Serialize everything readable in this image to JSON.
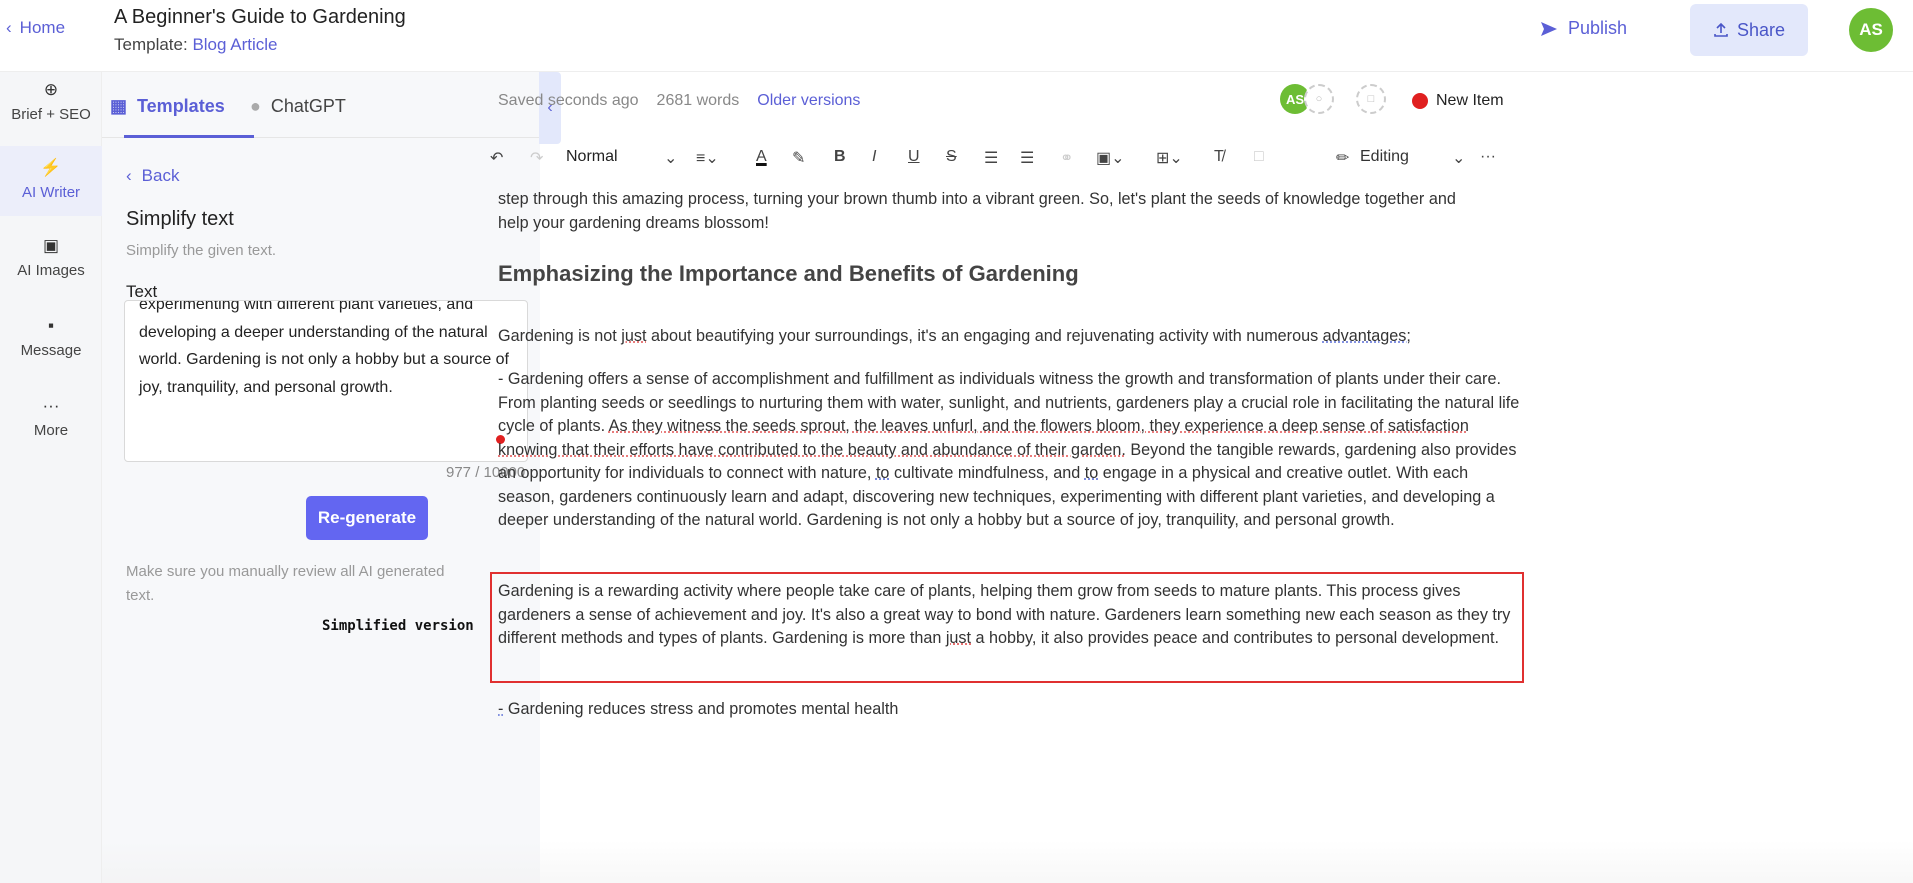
{
  "header": {
    "home_label": "Home",
    "doc_title": "A Beginner's Guide to Gardening",
    "template_prefix": "Template:",
    "template_name": "Blog Article",
    "publish_label": "Publish",
    "share_label": "Share",
    "avatar_initials": "AS"
  },
  "rail": {
    "items": [
      {
        "label": "Brief + SEO",
        "icon": "target-icon"
      },
      {
        "label": "AI Writer",
        "icon": "lightning-icon"
      },
      {
        "label": "AI Images",
        "icon": "image-icon"
      },
      {
        "label": "Message",
        "icon": "chat-bubble-icon"
      },
      {
        "label": "More",
        "icon": "more-dots-icon"
      }
    ]
  },
  "panel": {
    "tabs": [
      {
        "label": "Templates",
        "icon": "templates-icon"
      },
      {
        "label": "ChatGPT",
        "icon": "chat-icon"
      }
    ],
    "back_label": "Back",
    "tool_title": "Simplify text",
    "tool_description": "Simplify the given text.",
    "text_label": "Text",
    "text_value": "experimenting with different plant varieties, and developing a deeper understanding of the natural world. Gardening is not only a hobby but a source of joy, tranquility, and personal growth.",
    "char_count": "977 / 10000",
    "regenerate_label": "Re-generate",
    "review_note": "Make sure you manually review all AI generated text."
  },
  "editor": {
    "saved_status": "Saved seconds ago",
    "word_count": "2681 words",
    "older_versions_label": "Older versions",
    "collab_initials": "AS",
    "new_item_label": "New Item",
    "toolbar": {
      "style_label": "Normal",
      "bold": "B",
      "italic": "I",
      "underline": "U",
      "strike": "S",
      "editing_label": "Editing",
      "more": "···"
    },
    "intro_line_1": "step through this amazing process, turning your brown thumb into a vibrant green. So, let's plant the seeds of knowledge together and",
    "intro_line_2": "help your gardening dreams blossom!",
    "heading": "Emphasizing the Importance and Benefits of Gardening",
    "para1_a": "Gardening is not ",
    "para1_b": "just",
    "para1_c": " about beautifying your surroundings, it's an engaging and rejuvenating activity with numerous ",
    "para1_d": "advantages;",
    "para2_a": "- Gardening offers a sense of accomplishment and fulfillment as individuals witness the growth and transformation of plants under their care. From planting seeds or seedlings to nurturing them with water, sunlight, and nutrients, gardeners play a crucial role in facilitating the natural life cycle of plants. ",
    "para2_b": "As they witness the seeds sprout, the leaves unfurl, and the flowers bloom, they experience a deep sense of satisfaction knowing that their efforts have contributed to the beauty and abundance of their garden.",
    "para2_c": " Beyond the tangible rewards, gardening also provides an opportunity for individuals to connect with nature, ",
    "para2_d": "to",
    "para2_e": " cultivate mindfulness, and ",
    "para2_f": "to",
    "para2_g": " engage in a physical and creative outlet. With each season, gardeners continuously learn and adapt, discovering new techniques, experimenting with different plant varieties, and developing a deeper understanding of the natural world. Gardening is not only a hobby but a source of joy, tranquility, and personal growth.",
    "simplified_a": "Gardening is a rewarding activity where people take care of plants, helping them grow from seeds to mature plants. This process gives gardeners a sense of achievement and joy. It's also a great way to bond with nature. Gardeners learn something new each season as they try different methods and types of plants. Gardening is more than ",
    "simplified_b": "just",
    "simplified_c": " a hobby, it also provides peace and contributes to personal development.",
    "last_line_a": "-",
    "last_line_b": " Gardening reduces stress and promotes mental health",
    "annotation_label": "Simplified version"
  },
  "colors": {
    "accent": "#5b5fd6",
    "avatar_green": "#6dbd34",
    "button_primary": "#6366f1",
    "highlight_box": "#e03030"
  }
}
